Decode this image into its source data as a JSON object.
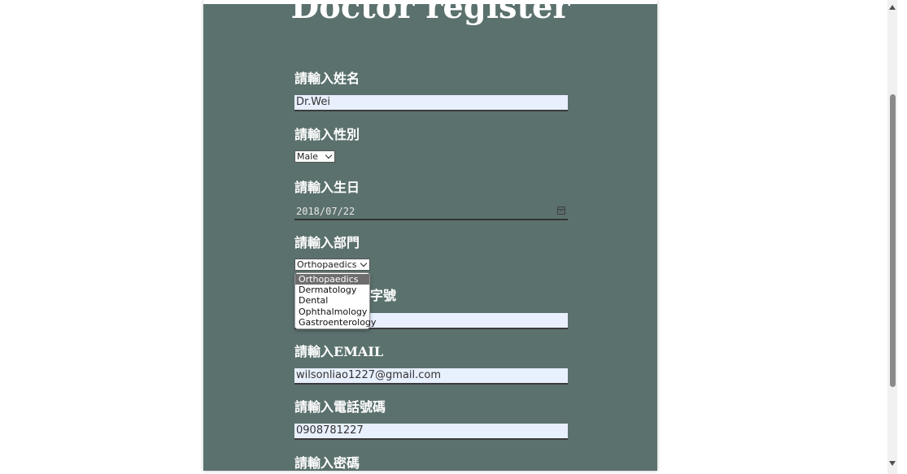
{
  "page_title": "Doctor register",
  "form": {
    "name": {
      "label": "請輸入姓名",
      "value": "Dr.Wei"
    },
    "gender": {
      "label": "請輸入性別",
      "selected": "Male"
    },
    "birthday": {
      "label": "請輸入生日",
      "value": "2018/07/22"
    },
    "department": {
      "label": "請輸入部門",
      "selected": "Orthopaedics",
      "options": [
        "Orthopaedics",
        "Dermatology",
        "Dental",
        "Ophthalmology",
        "Gastroenterology"
      ]
    },
    "license": {
      "label_visible": "字號",
      "value": ""
    },
    "email": {
      "label_prefix": "請輸入",
      "label_suffix": "EMAIL",
      "value": "wilsonliao1227@gmail.com"
    },
    "phone": {
      "label": "請輸入電話號碼",
      "value": "0908781227"
    },
    "password": {
      "label": "請輸入密碼"
    }
  },
  "colors": {
    "panel": "#5b716e",
    "input_bg": "#e8f0fe"
  },
  "icons": {
    "calendar": "calendar-icon",
    "dropdown": "chevron-down-icon"
  }
}
